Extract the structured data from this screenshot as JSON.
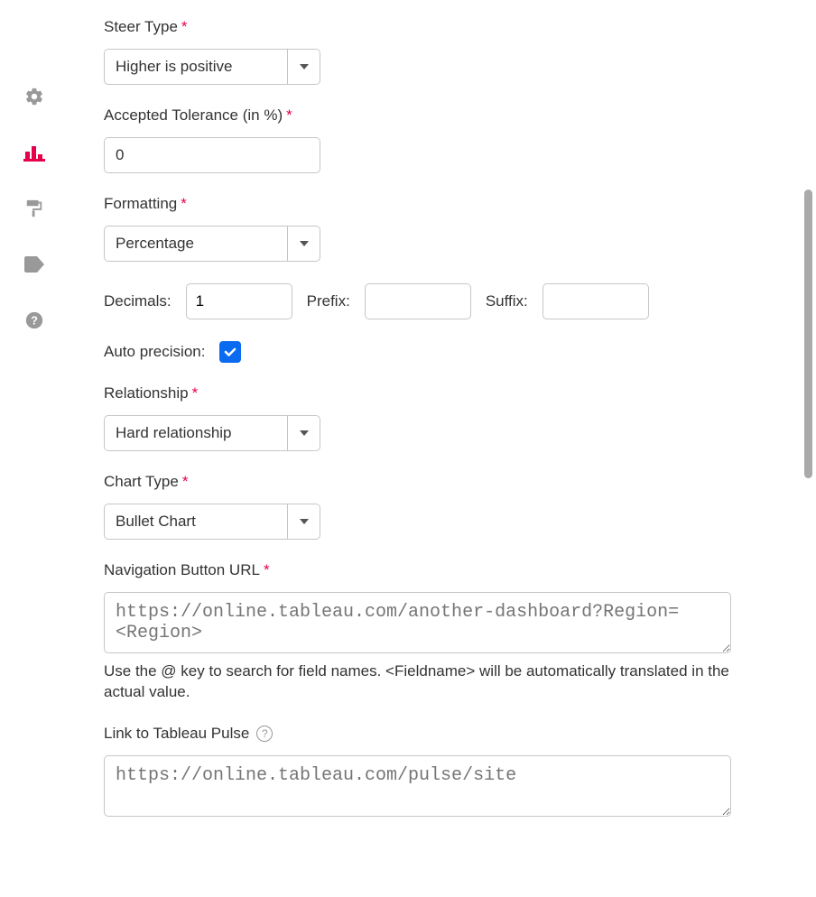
{
  "sidebar": {
    "icons": [
      "gear-icon",
      "chart-bar-icon",
      "paint-roller-icon",
      "tag-icon",
      "help-icon"
    ]
  },
  "form": {
    "steerType": {
      "label": "Steer Type",
      "required": true,
      "value": "Higher is positive"
    },
    "acceptedTolerance": {
      "label": "Accepted Tolerance (in %)",
      "required": true,
      "value": "0"
    },
    "formatting": {
      "label": "Formatting",
      "required": true,
      "value": "Percentage"
    },
    "decimals": {
      "label": "Decimals:",
      "value": "1"
    },
    "prefix": {
      "label": "Prefix:",
      "value": ""
    },
    "suffix": {
      "label": "Suffix:",
      "value": ""
    },
    "autoPrecision": {
      "label": "Auto precision:",
      "checked": true
    },
    "relationship": {
      "label": "Relationship",
      "required": true,
      "value": "Hard relationship"
    },
    "chartType": {
      "label": "Chart Type",
      "required": true,
      "value": "Bullet Chart"
    },
    "navUrl": {
      "label": "Navigation Button URL",
      "required": true,
      "placeholder": "https://online.tableau.com/another-dashboard?Region=<Region>",
      "help": "Use the @ key to search for field names. <Fieldname> will be automatically translated in the actual value."
    },
    "pulseLink": {
      "label": "Link to Tableau Pulse",
      "placeholder": "https://online.tableau.com/pulse/site"
    }
  }
}
